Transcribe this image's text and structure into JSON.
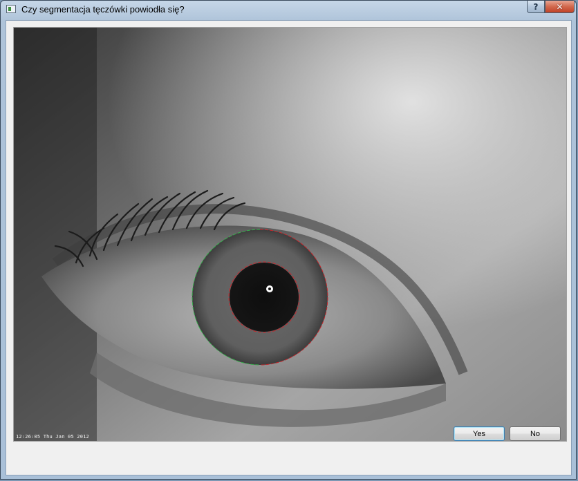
{
  "window": {
    "title": "Czy segmentacja tęczówki powiodła się?",
    "help_label": "?",
    "close_label": "✕"
  },
  "image": {
    "timestamp": "12:26:05 Thu Jan 05 2012",
    "pupil_outline_color": "#c8282d",
    "iris_outline_colors": [
      "#35b04a",
      "#c8282d"
    ]
  },
  "buttons": {
    "yes_label": "Yes",
    "no_label": "No"
  }
}
